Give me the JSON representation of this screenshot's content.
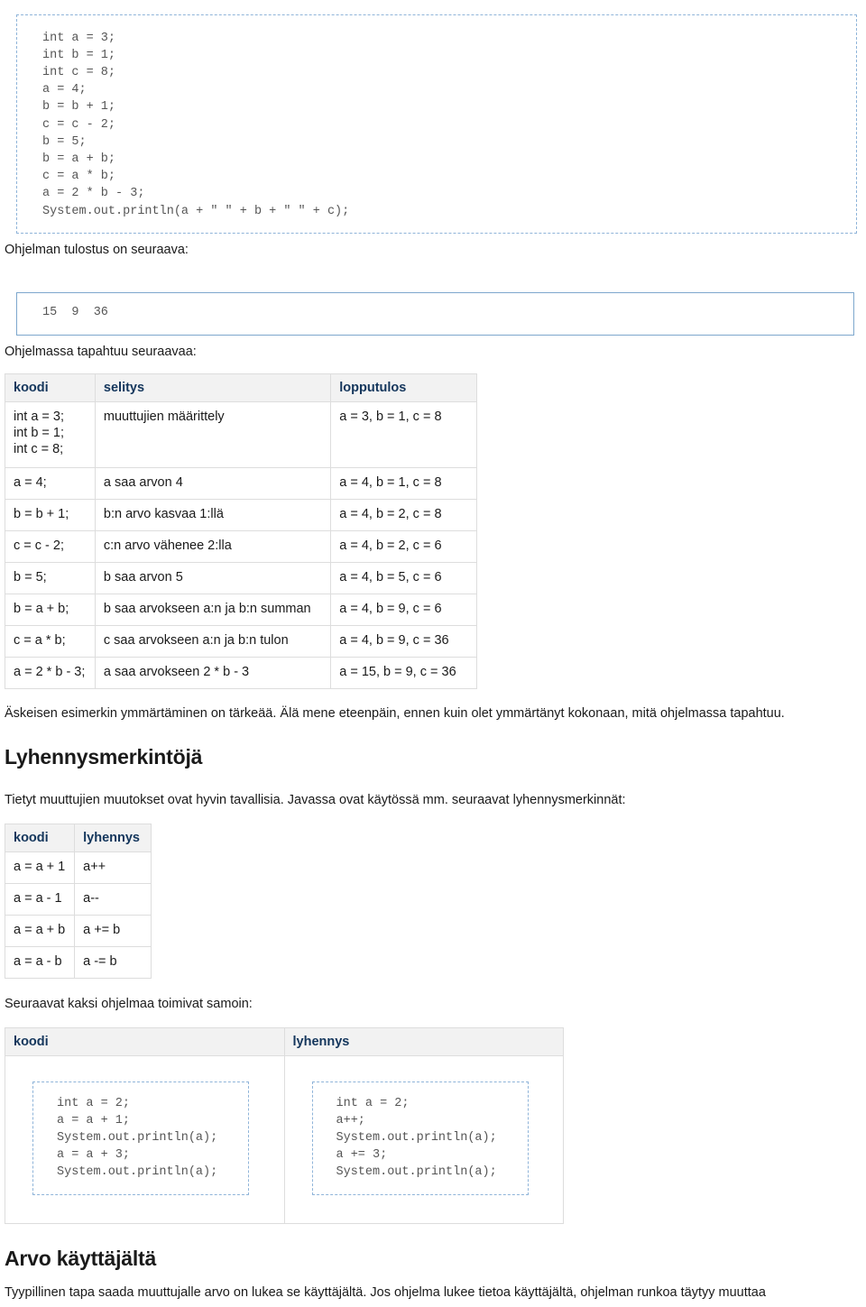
{
  "code_top": {
    "lines": "int a = 3;\nint b = 1;\nint c = 8;\na = 4;\nb = b + 1;\nc = c - 2;\nb = 5;\nb = a + b;\nc = a * b;\na = 2 * b - 3;\nSystem.out.println(a + \" \" + b + \" \" + c);"
  },
  "paragraphs": {
    "tulostus": "Ohjelman tulostus on seuraava:",
    "tapahtuu": "Ohjelmassa tapahtuu seuraavaa:",
    "askeisen": "Äskeisen esimerkin ymmärtäminen on tärkeää. Älä mene eteenpäin, ennen kuin olet ymmärtänyt kokonaan, mitä ohjelmassa tapahtuu.",
    "tietyt": "Tietyt muuttujien muutokset ovat hyvin tavallisia. Javassa ovat käytössä mm. seuraavat lyhennysmerkinnät:",
    "seuraavat": "Seuraavat kaksi ohjelmaa toimivat samoin:",
    "tyypillinen": "Tyypillinen tapa saada muuttujalle arvo on lukea se käyttäjältä. Jos ohjelma lukee tietoa käyttäjältä, ohjelman runkoa täytyy muuttaa"
  },
  "output_box": {
    "text": "15  9  36"
  },
  "headings": {
    "lyhennysmerkintoja": "Lyhennysmerkintöjä",
    "arvo_kayttajalta": "Arvo käyttäjältä"
  },
  "table_steps": {
    "headers": [
      "koodi",
      "selitys",
      "lopputulos"
    ],
    "rows": [
      [
        "int a = 3;\nint b = 1;\nint c = 8;",
        "muuttujien määrittely",
        "a = 3, b = 1, c = 8"
      ],
      [
        "a = 4;",
        "a saa arvon 4",
        "a = 4, b = 1, c = 8"
      ],
      [
        "b = b + 1;",
        "b:n arvo kasvaa 1:llä",
        "a = 4, b = 2, c = 8"
      ],
      [
        "c = c - 2;",
        "c:n arvo vähenee 2:lla",
        "a = 4, b = 2, c = 6"
      ],
      [
        "b = 5;",
        "b saa arvon 5",
        "a = 4, b = 5, c = 6"
      ],
      [
        "b = a + b;",
        "b saa arvokseen a:n ja b:n summan",
        "a = 4, b = 9, c = 6"
      ],
      [
        "c = a * b;",
        "c saa arvokseen a:n ja b:n tulon",
        "a = 4, b = 9, c = 36"
      ],
      [
        "a = 2 * b - 3;",
        "a saa arvokseen 2 * b - 3",
        "a = 15, b = 9, c = 36"
      ]
    ]
  },
  "table_shorthand": {
    "headers": [
      "koodi",
      "lyhennys"
    ],
    "rows": [
      [
        "a = a + 1",
        "a++"
      ],
      [
        "a = a - 1",
        "a--"
      ],
      [
        "a = a + b",
        "a += b"
      ],
      [
        "a = a - b",
        "a -= b"
      ]
    ]
  },
  "table_compare": {
    "headers": [
      "koodi",
      "lyhennys"
    ],
    "cell_left": "int a = 2;\na = a + 1;\nSystem.out.println(a);\na = a + 3;\nSystem.out.println(a);",
    "cell_right": "int a = 2;\na++;\nSystem.out.println(a);\na += 3;\nSystem.out.println(a);"
  },
  "colors": {
    "code_border": "#8fb4d9",
    "output_border": "#7da7cd",
    "table_header_bg": "#f2f2f2",
    "table_header_text": "#14365c",
    "table_border": "#dddddd",
    "code_text": "#555555"
  }
}
